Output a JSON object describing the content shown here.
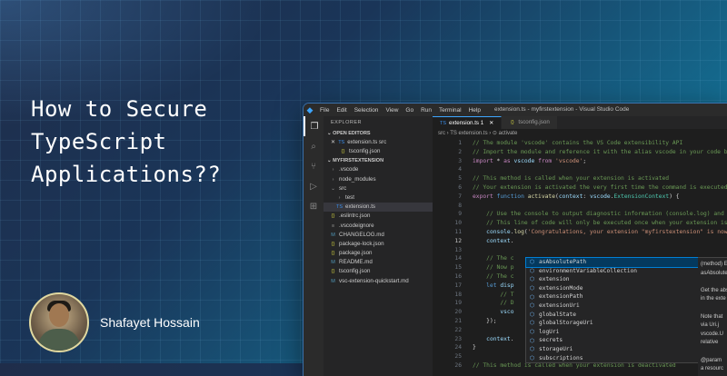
{
  "article": {
    "title_lines": [
      "How to Secure",
      "TypeScript",
      "Applications??"
    ],
    "author": "Shafayet Hossain"
  },
  "vscode": {
    "menu": [
      "File",
      "Edit",
      "Selection",
      "View",
      "Go",
      "Run",
      "Terminal",
      "Help"
    ],
    "window_title": "extension.ts - myfirstextension - Visual Studio Code",
    "activity_icons": [
      "files-icon",
      "search-icon",
      "source-control-icon",
      "run-debug-icon",
      "extensions-icon"
    ],
    "explorer_header": "EXPLORER",
    "open_editors_label": "OPEN EDITORS",
    "open_editors": [
      {
        "name": "extension.ts src",
        "icon": "TS",
        "close": "✕"
      },
      {
        "name": "tsconfig.json",
        "icon": "{}",
        "close": ""
      }
    ],
    "project_label": "MYFIRSTEXTENSION",
    "tree": [
      {
        "name": ".vscode",
        "icon": "›",
        "depth": 1
      },
      {
        "name": "node_modules",
        "icon": "›",
        "depth": 1
      },
      {
        "name": "src",
        "icon": "⌄",
        "depth": 1
      },
      {
        "name": "test",
        "icon": "›",
        "depth": 2
      },
      {
        "name": "extension.ts",
        "icon": "TS",
        "depth": 2,
        "selected": true
      },
      {
        "name": ".eslintrc.json",
        "icon": "{}",
        "depth": 1
      },
      {
        "name": ".vscodeignore",
        "icon": "≡",
        "depth": 1
      },
      {
        "name": "CHANGELOG.md",
        "icon": "M",
        "depth": 1
      },
      {
        "name": "package-lock.json",
        "icon": "{}",
        "depth": 1
      },
      {
        "name": "package.json",
        "icon": "{}",
        "depth": 1
      },
      {
        "name": "README.md",
        "icon": "M",
        "depth": 1
      },
      {
        "name": "tsconfig.json",
        "icon": "{}",
        "depth": 1
      },
      {
        "name": "vsc-extension-quickstart.md",
        "icon": "M",
        "depth": 1
      }
    ],
    "tabs": [
      {
        "label": "extension.ts 1",
        "active": true
      },
      {
        "label": "tsconfig.json",
        "active": false
      }
    ],
    "breadcrumb": "src › TS extension.ts › ⊙ activate",
    "code_lines": [
      {
        "n": "1",
        "html": "<span class='c'>// The module 'vscode' contains the VS Code extensibility API</span>"
      },
      {
        "n": "2",
        "html": "<span class='c'>// Import the module and reference it with the alias vscode in your code below</span>"
      },
      {
        "n": "3",
        "html": "<span class='k'>import</span> * <span class='k'>as</span> <span class='v'>vscode</span> <span class='k'>from</span> <span class='s'>'vscode'</span>;"
      },
      {
        "n": "4",
        "html": ""
      },
      {
        "n": "5",
        "html": "<span class='c'>// This method is called when your extension is activated</span>"
      },
      {
        "n": "6",
        "html": "<span class='c'>// Your extension is activated the very first time the command is executed</span>"
      },
      {
        "n": "7",
        "html": "<span class='k'>export</span> <span class='kw'>function</span> <span class='f'>activate</span>(<span class='v'>context</span>: <span class='v'>vscode</span>.<span class='t'>ExtensionContext</span>) {"
      },
      {
        "n": "8",
        "html": ""
      },
      {
        "n": "9",
        "html": "    <span class='c'>// Use the console to output diagnostic information (console.log) and errors</span>"
      },
      {
        "n": "10",
        "html": "    <span class='c'>// This line of code will only be executed once when your extension is activated</span>"
      },
      {
        "n": "11",
        "html": "    <span class='v'>console</span>.<span class='f'>log</span>(<span class='s'>'Congratulations, your extension \"myfirstextension\" is now active!'</span>);"
      },
      {
        "n": "12",
        "html": "    <span class='v'>context</span>.",
        "current": true
      },
      {
        "n": "13",
        "html": ""
      },
      {
        "n": "14",
        "html": "    <span class='c'>// The c</span>"
      },
      {
        "n": "15",
        "html": "    <span class='c'>// Now p</span>"
      },
      {
        "n": "16",
        "html": "    <span class='c'>// The c</span>"
      },
      {
        "n": "17",
        "html": "    <span class='kw'>let</span> <span class='v'>disp</span>"
      },
      {
        "n": "18",
        "html": "        <span class='c'>// T</span>"
      },
      {
        "n": "19",
        "html": "        <span class='c'>// D</span>"
      },
      {
        "n": "20",
        "html": "        <span class='v'>vsco</span>"
      },
      {
        "n": "21",
        "html": "    });"
      },
      {
        "n": "22",
        "html": ""
      },
      {
        "n": "23",
        "html": "    <span class='v'>context</span>."
      },
      {
        "n": "24",
        "html": "}"
      },
      {
        "n": "25",
        "html": ""
      },
      {
        "n": "26",
        "html": "<span class='c'>// This method is called when your extension is deactivated</span>"
      }
    ],
    "suggestions": [
      {
        "label": "asAbsolutePath",
        "selected": true
      },
      {
        "label": "environmentVariableCollection"
      },
      {
        "label": "extension"
      },
      {
        "label": "extensionMode"
      },
      {
        "label": "extensionPath"
      },
      {
        "label": "extensionUri"
      },
      {
        "label": "globalState"
      },
      {
        "label": "globalStorageUri"
      },
      {
        "label": "logUri"
      },
      {
        "label": "secrets"
      },
      {
        "label": "storageUri"
      },
      {
        "label": "subscriptions"
      }
    ],
    "detail_lines": [
      "(method) E",
      "asAbsolutePath(re",
      "",
      "Get the abs",
      "in the exte",
      "",
      "Note that",
      "via Uri.j",
      "vscode.U",
      "relative",
      "",
      "@param",
      "a resourc"
    ]
  },
  "colors": {
    "accent": "#3ea6ff",
    "bg_start": "#1f2d4a",
    "bg_end": "#1590b4"
  }
}
